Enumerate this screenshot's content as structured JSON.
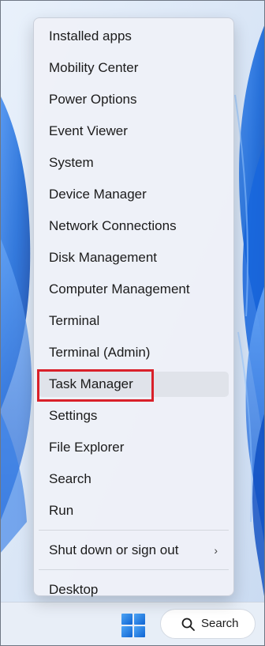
{
  "context_menu": {
    "items": [
      {
        "label": "Installed apps"
      },
      {
        "label": "Mobility Center"
      },
      {
        "label": "Power Options"
      },
      {
        "label": "Event Viewer"
      },
      {
        "label": "System"
      },
      {
        "label": "Device Manager"
      },
      {
        "label": "Network Connections"
      },
      {
        "label": "Disk Management"
      },
      {
        "label": "Computer Management"
      },
      {
        "label": "Terminal"
      },
      {
        "label": "Terminal (Admin)"
      },
      {
        "label": "Task Manager",
        "highlighted": true
      },
      {
        "label": "Settings"
      },
      {
        "label": "File Explorer"
      },
      {
        "label": "Search"
      },
      {
        "label": "Run"
      },
      {
        "label": "Shut down or sign out",
        "submenu": true,
        "chevron": "›"
      },
      {
        "label": "Desktop"
      }
    ]
  },
  "taskbar": {
    "start_icon": "windows-logo-icon",
    "search_icon": "search-icon",
    "search_label": "Search"
  },
  "colors": {
    "highlight_border": "#d9202a",
    "accent_blue": "#1a73d9"
  }
}
